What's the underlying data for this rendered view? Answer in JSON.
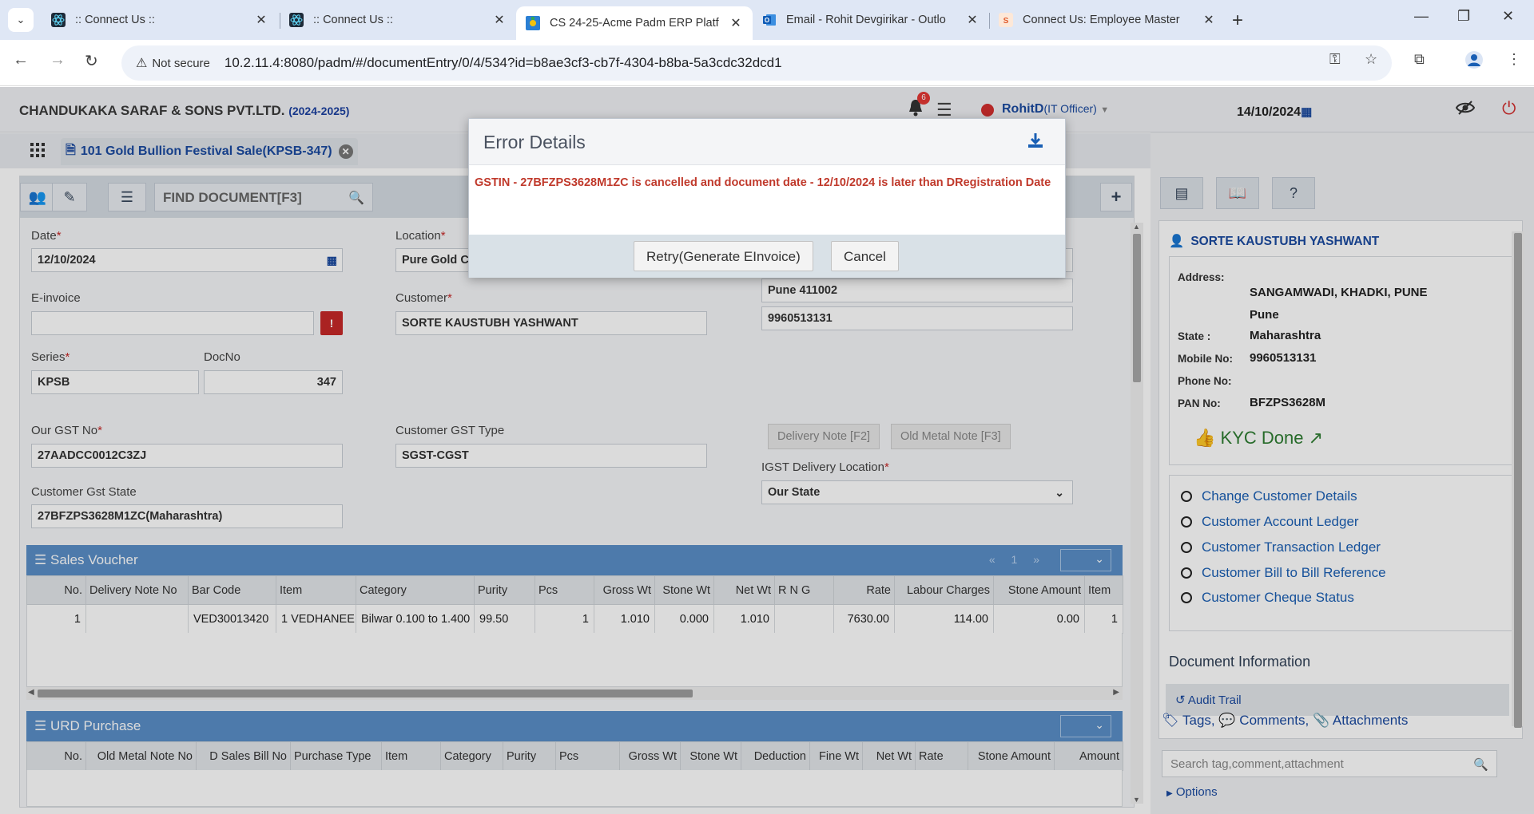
{
  "browser": {
    "tabs": [
      {
        "title": ":: Connect Us ::",
        "active": false
      },
      {
        "title": ":: Connect Us ::",
        "active": false
      },
      {
        "title": "CS 24-25-Acme Padm ERP Platf",
        "active": true
      },
      {
        "title": "Email - Rohit Devgirikar - Outlo",
        "active": false
      },
      {
        "title": "Connect Us: Employee Master",
        "active": false
      }
    ],
    "security_label": "Not secure",
    "url": "10.2.11.4:8080/padm/#/documentEntry/0/4/534?id=b8ae3cf3-cb7f-4304-b8ba-5a3cdc32dcd1"
  },
  "header": {
    "company": "CHANDUKAKA SARAF & SONS PVT.LTD.",
    "year": "(2024-2025)",
    "notification_count": "6",
    "user": "RohitD",
    "role": "(IT Officer)",
    "date": "14/10/2024"
  },
  "doc_tab": {
    "title": "101 Gold Bullion Festival Sale(KPSB-347)"
  },
  "toolbar": {
    "find_placeholder": "FIND DOCUMENT[F3]"
  },
  "form": {
    "date_label": "Date",
    "date_value": "12/10/2024",
    "location_label": "Location",
    "location_value": "Pure Gold C",
    "einvoice_label": "E-invoice",
    "einvoice_value": "",
    "customer_label": "Customer",
    "customer_value": "SORTE KAUSTUBH YASHWANT",
    "address_line": "Pune 411002",
    "phone_value": "9960513131",
    "series_label": "Series",
    "series_value": "KPSB",
    "docno_label": "DocNo",
    "docno_value": "347",
    "our_gst_label": "Our GST No",
    "our_gst_value": "27AADCC0012C3ZJ",
    "cust_gst_type_label": "Customer GST Type",
    "cust_gst_type_value": "SGST-CGST",
    "delivery_note_btn": "Delivery Note [F2]",
    "old_metal_note_btn": "Old Metal Note [F3]",
    "igst_label": "IGST Delivery Location",
    "igst_value": "Our State",
    "cust_gst_state_label": "Customer Gst State",
    "cust_gst_state_value": "27BFZPS3628M1ZC(Maharashtra)"
  },
  "sales_voucher": {
    "title": "Sales Voucher",
    "pager": "« 1 »",
    "columns": [
      "No.",
      "Delivery Note No",
      "Bar Code",
      "Item",
      "Category",
      "Purity",
      "Pcs",
      "Gross Wt",
      "Stone Wt",
      "Net Wt",
      "R N G",
      "Rate",
      "Labour Charges",
      "Stone Amount",
      "Item"
    ],
    "rows": [
      [
        "1",
        "",
        "VED30013420",
        "1 VEDHANEE",
        "Bilwar 0.100 to 1.400",
        "99.50",
        "1",
        "1.010",
        "0.000",
        "1.010",
        "",
        "7630.00",
        "114.00",
        "0.00",
        "1"
      ]
    ]
  },
  "urd_purchase": {
    "title": "URD Purchase",
    "columns": [
      "No.",
      "Old Metal Note No",
      "D Sales Bill No",
      "Purchase Type",
      "Item",
      "Category",
      "Purity",
      "Pcs",
      "Gross Wt",
      "Stone Wt",
      "Deduction",
      "Fine Wt",
      "Net Wt",
      "Rate",
      "Stone Amount",
      "Amount"
    ]
  },
  "customer_panel": {
    "name": "SORTE KAUSTUBH YASHWANT",
    "address_label": "Address:",
    "address_line1": "SANGAMWADI, KHADKI, PUNE",
    "address_line2": "Pune",
    "state_label": "State :",
    "state_value": "Maharashtra",
    "mobile_label": "Mobile No:",
    "mobile_value": "9960513131",
    "phone_label": "Phone No:",
    "phone_value": "",
    "pan_label": "PAN No:",
    "pan_value": "BFZPS3628M",
    "kyc": "KYC Done",
    "links": [
      "Change Customer Details",
      "Customer Account Ledger",
      "Customer Transaction Ledger",
      "Customer Bill to Bill Reference",
      "Customer Cheque Status"
    ],
    "doc_info_title": "Document Information",
    "audit_trail": "Audit Trail",
    "tags": "Tags,",
    "comments": "Comments,",
    "attachments": "Attachments",
    "search_placeholder": "Search tag,comment,attachment",
    "options": "Options"
  },
  "modal": {
    "title": "Error Details",
    "message": "GSTIN - 27BFZPS3628M1ZC is cancelled and document date - 12/10/2024 is later than DRegistration Date",
    "retry_label": "Retry(Generate EInvoice)",
    "cancel_label": "Cancel"
  },
  "colors": {
    "section_header": "#5a8fc8",
    "error_text": "#c0392b",
    "link": "#1a5fb4",
    "kyc": "#2e7d32"
  }
}
